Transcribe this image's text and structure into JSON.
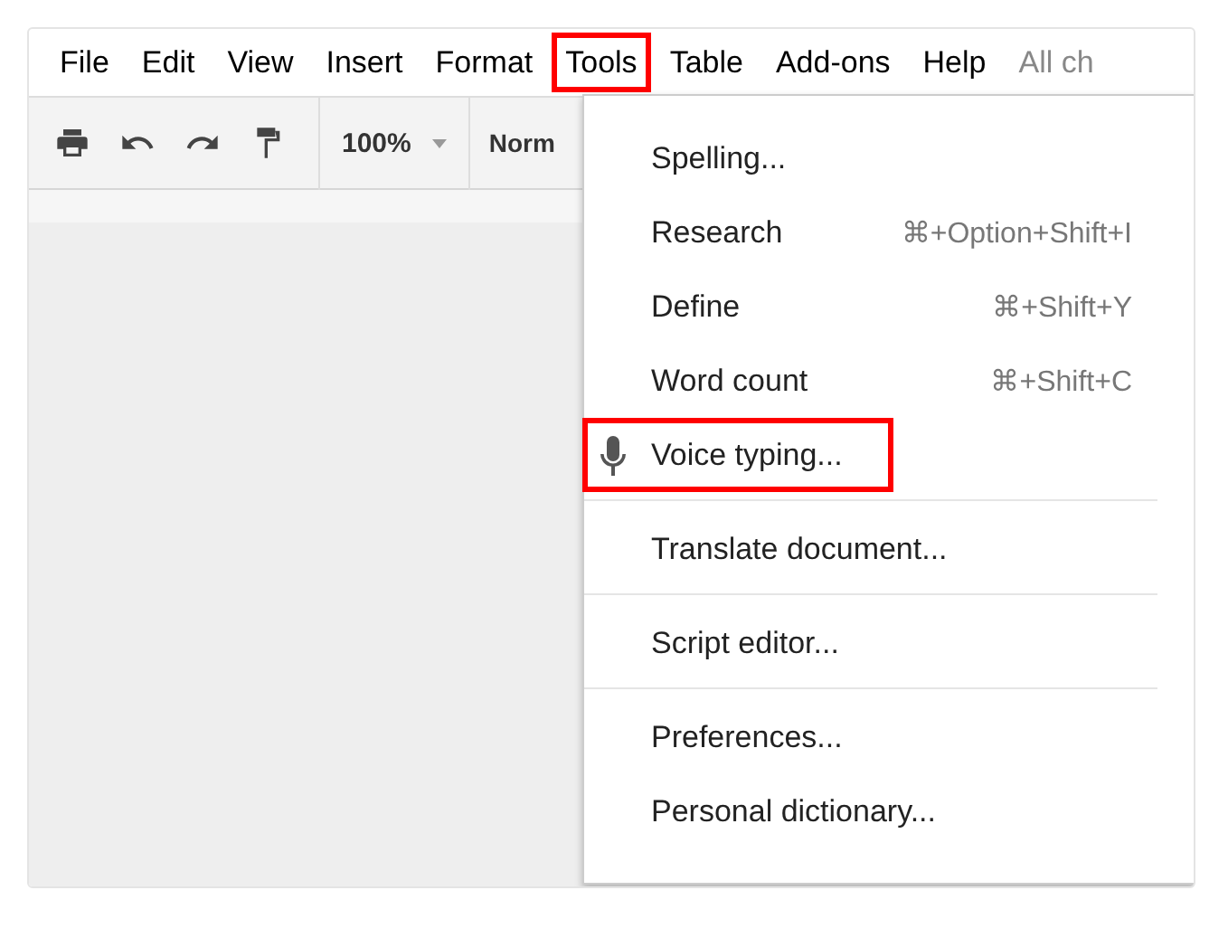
{
  "menu_bar": [
    {
      "label": "File",
      "highlighted": false
    },
    {
      "label": "Edit",
      "highlighted": false
    },
    {
      "label": "View",
      "highlighted": false
    },
    {
      "label": "Insert",
      "highlighted": false
    },
    {
      "label": "Format",
      "highlighted": false
    },
    {
      "label": "Tools",
      "highlighted": true
    },
    {
      "label": "Table",
      "highlighted": false
    },
    {
      "label": "Add-ons",
      "highlighted": false
    },
    {
      "label": "Help",
      "highlighted": false
    }
  ],
  "status_text": "All ch",
  "toolbar": {
    "zoom": "100%",
    "style": "Norm"
  },
  "dropdown": {
    "groups": [
      [
        {
          "kind": "plain",
          "label": "Spelling...",
          "highlighted": false
        },
        {
          "kind": "plain",
          "label": "Research",
          "shortcut": "⌘+Option+Shift+I",
          "highlighted": false
        },
        {
          "kind": "plain",
          "label": "Define",
          "shortcut": "⌘+Shift+Y",
          "highlighted": false
        },
        {
          "kind": "plain",
          "label": "Word count",
          "shortcut": "⌘+Shift+C",
          "highlighted": false
        },
        {
          "kind": "voice",
          "label": "Voice typing...",
          "highlighted": true
        }
      ],
      [
        {
          "kind": "plain",
          "label": "Translate document...",
          "highlighted": false
        }
      ],
      [
        {
          "kind": "plain",
          "label": "Script editor...",
          "highlighted": false
        }
      ],
      [
        {
          "kind": "plain",
          "label": "Preferences...",
          "highlighted": false
        },
        {
          "kind": "plain",
          "label": "Personal dictionary...",
          "highlighted": false
        }
      ]
    ]
  }
}
